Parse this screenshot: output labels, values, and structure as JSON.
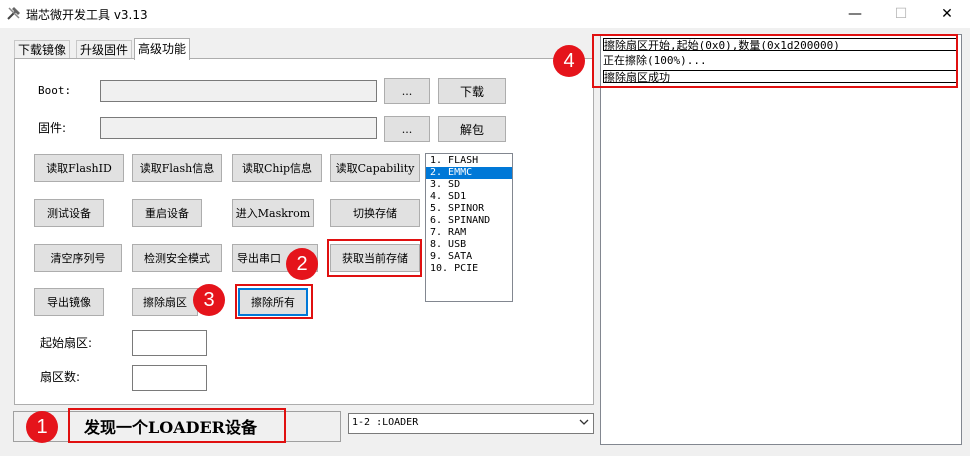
{
  "window": {
    "title": "瑞芯微开发工具 v3.13",
    "controls": {
      "minimize": "—",
      "maximize": "☐",
      "close": "✕"
    }
  },
  "tabs": [
    {
      "label": "下载镜像"
    },
    {
      "label": "升级固件"
    },
    {
      "label": "高级功能"
    }
  ],
  "active_tab": "高级功能",
  "form": {
    "boot_label": "Boot:",
    "boot_browse": "...",
    "boot_download": "下载",
    "firmware_label": "固件:",
    "firmware_browse": "...",
    "firmware_unpack": "解包"
  },
  "buttons": {
    "read_flash_id": "读取FlashID",
    "read_flash_info": "读取Flash信息",
    "read_chip_info": "读取Chip信息",
    "read_capability": "读取Capability",
    "test_device": "测试设备",
    "reboot_device": "重启设备",
    "enter_maskrom": "进入Maskrom",
    "switch_storage": "切换存储",
    "clear_serial": "清空序列号",
    "detect_secure_mode": "检测安全模式",
    "export_serial_log": "导出串口",
    "get_current_storage": "获取当前存储",
    "export_image": "导出镜像",
    "erase_sector": "擦除扇区",
    "erase_all": "擦除所有"
  },
  "sector_form": {
    "start_label": "起始扇区:",
    "count_label": "扇区数:"
  },
  "storage_list": {
    "items": [
      "1. FLASH",
      "2. EMMC",
      "3. SD",
      "4. SD1",
      "5. SPINOR",
      "6. SPINAND",
      "7. RAM",
      "8. USB",
      "9. SATA",
      "10. PCIE"
    ],
    "selected_index": 1
  },
  "log": {
    "lines": [
      "擦除扇区开始,起始(0x0),数量(0x1d200000)",
      "正在擦除(100%)...",
      "擦除扇区成功"
    ]
  },
  "status": {
    "text": "发现一个LOADER设备"
  },
  "device_combo": {
    "value": "1-2 :LOADER"
  },
  "annotations": {
    "m1": "1",
    "m2": "2",
    "m3": "3",
    "m4": "4",
    "color": "#e5141b"
  }
}
